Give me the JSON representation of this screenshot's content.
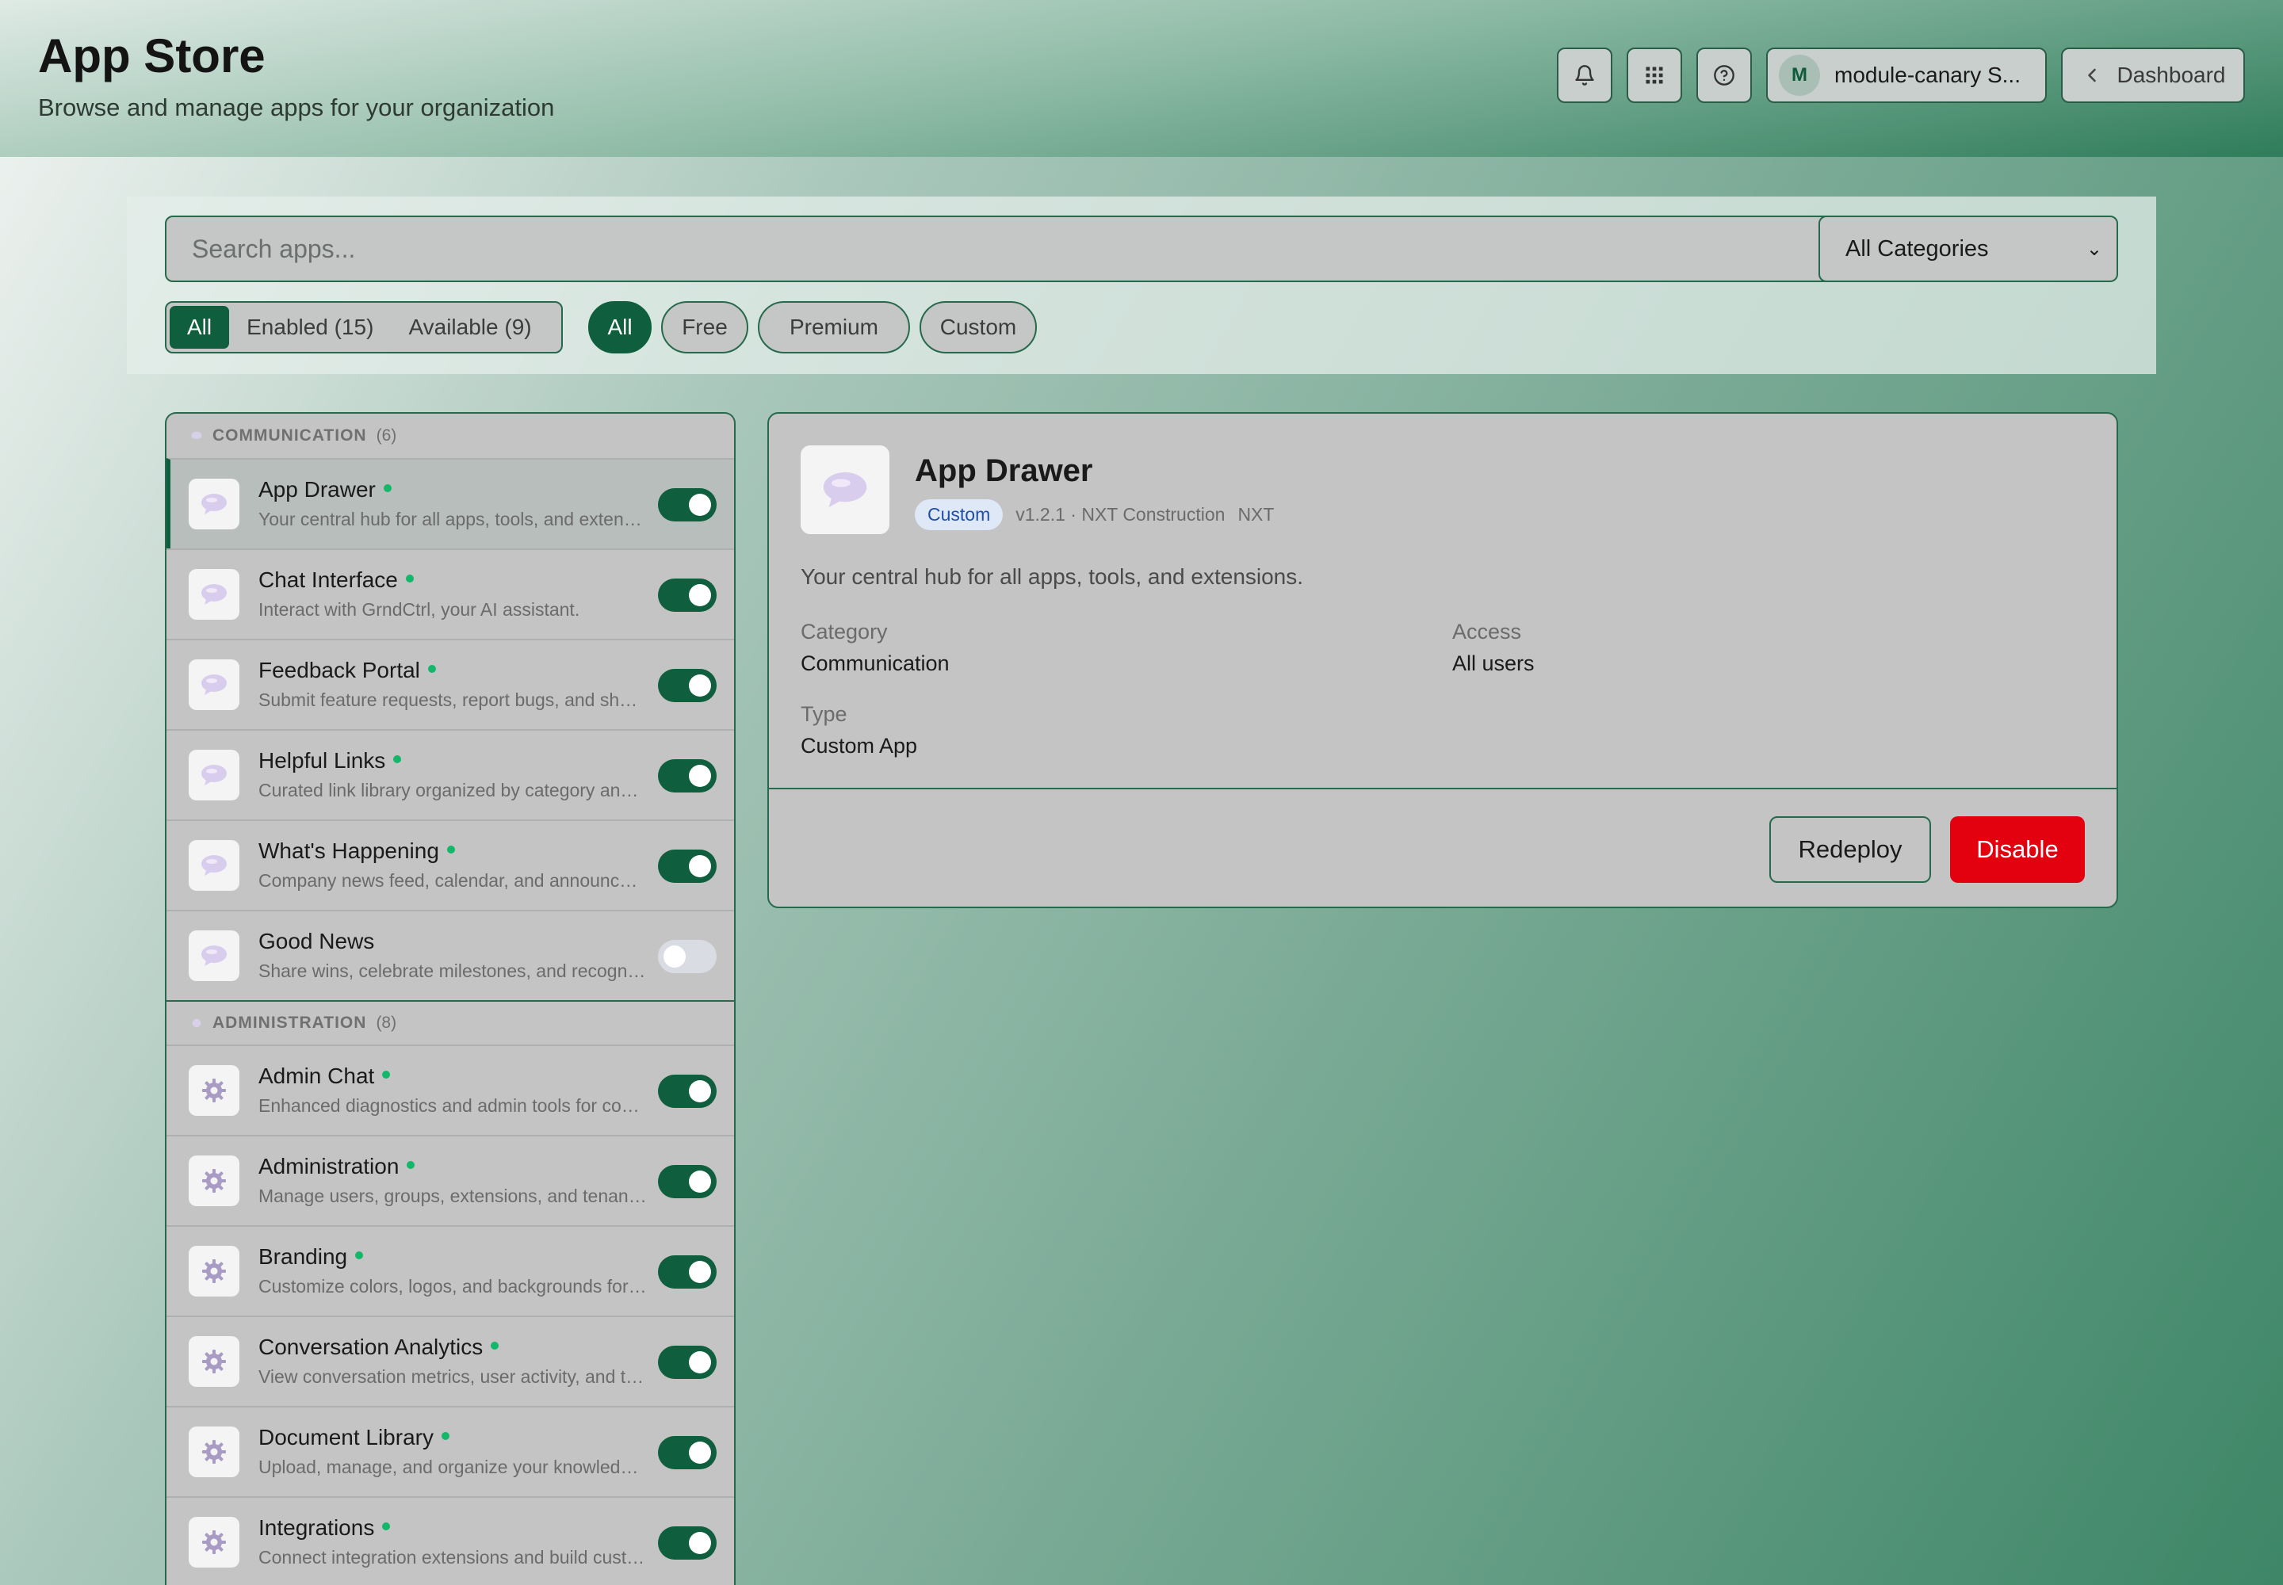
{
  "header": {
    "title": "App Store",
    "subtitle": "Browse and manage apps for your organization",
    "icons": [
      "bell-icon",
      "grid-icon",
      "help-icon"
    ],
    "user": {
      "initial": "M",
      "name": "module-canary S..."
    },
    "dashboard_label": "Dashboard"
  },
  "filters": {
    "search_placeholder": "Search apps...",
    "category_select": "All Categories",
    "status_tabs": [
      {
        "label": "All",
        "active": true
      },
      {
        "label": "Enabled (15)",
        "active": false
      },
      {
        "label": "Available (9)",
        "active": false
      }
    ],
    "type_pills": [
      {
        "label": "All",
        "active": true
      },
      {
        "label": "Free",
        "active": false
      },
      {
        "label": "Premium",
        "active": false
      },
      {
        "label": "Custom",
        "active": false
      }
    ]
  },
  "categories": [
    {
      "name": "COMMUNICATION",
      "count": "(6)",
      "icon": "chat-bubble-icon",
      "apps": [
        {
          "name": "App Drawer",
          "desc": "Your central hub for all apps, tools, and extensions.",
          "enabled": true,
          "selected": true
        },
        {
          "name": "Chat Interface",
          "desc": "Interact with GrndCtrl, your AI assistant.",
          "enabled": true
        },
        {
          "name": "Feedback Portal",
          "desc": "Submit feature requests, report bugs, and share feedback.",
          "enabled": true
        },
        {
          "name": "Helpful Links",
          "desc": "Curated link library organized by category and tags.",
          "enabled": true
        },
        {
          "name": "What's Happening",
          "desc": "Company news feed, calendar, and announcements.",
          "enabled": true
        },
        {
          "name": "Good News",
          "desc": "Share wins, celebrate milestones, and recognize teammates.",
          "enabled": false
        }
      ]
    },
    {
      "name": "ADMINISTRATION",
      "count": "(8)",
      "icon": "gear-icon",
      "apps": [
        {
          "name": "Admin Chat",
          "desc": "Enhanced diagnostics and admin tools for conversations.",
          "enabled": true
        },
        {
          "name": "Administration",
          "desc": "Manage users, groups, extensions, and tenant settings.",
          "enabled": true
        },
        {
          "name": "Branding",
          "desc": "Customize colors, logos, and backgrounds for your tenant.",
          "enabled": true
        },
        {
          "name": "Conversation Analytics",
          "desc": "View conversation metrics, user activity, and trends.",
          "enabled": true
        },
        {
          "name": "Document Library",
          "desc": "Upload, manage, and organize your knowledge base.",
          "enabled": true
        },
        {
          "name": "Integrations",
          "desc": "Connect integration extensions and build custom tools.",
          "enabled": true
        }
      ]
    }
  ],
  "detail": {
    "title": "App Drawer",
    "badge": "Custom",
    "meta": "v1.2.1 · NXT Construction",
    "meta_tag": "NXT",
    "description": "Your central hub for all apps, tools, and extensions.",
    "category_label": "Category",
    "category_value": "Communication",
    "access_label": "Access",
    "access_value": "All users",
    "type_label": "Type",
    "type_value": "Custom App",
    "redeploy_label": "Redeploy",
    "disable_label": "Disable"
  },
  "colors": {
    "accent": "#0f5f3e",
    "danger": "#e3000f",
    "status_dot": "#12b76a"
  }
}
